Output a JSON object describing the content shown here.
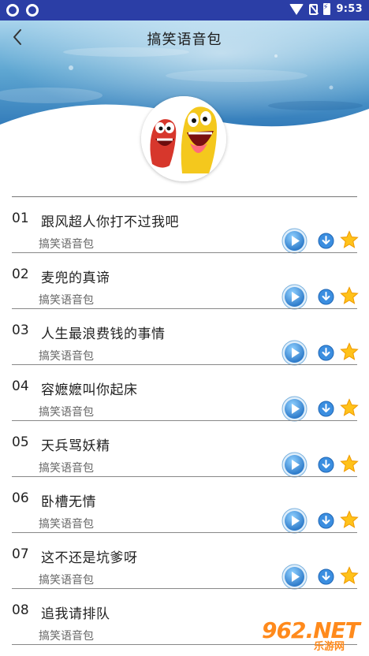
{
  "status_bar": {
    "time": "9:53",
    "left_icons": [
      "sync-icon",
      "sync-icon"
    ],
    "right_icons": [
      "wifi-icon",
      "no-sim-icon",
      "battery-charging-icon"
    ]
  },
  "header": {
    "title": "搞笑语音包",
    "back_icon": "chevron-left-icon"
  },
  "list": {
    "items": [
      {
        "num": "01",
        "title": "跟风超人你打不过我吧",
        "subtitle": "搞笑语音包"
      },
      {
        "num": "02",
        "title": "麦兜的真谛",
        "subtitle": "搞笑语音包"
      },
      {
        "num": "03",
        "title": "人生最浪费钱的事情",
        "subtitle": "搞笑语音包"
      },
      {
        "num": "04",
        "title": "容嬷嬷叫你起床",
        "subtitle": "搞笑语音包"
      },
      {
        "num": "05",
        "title": "天兵骂妖精",
        "subtitle": "搞笑语音包"
      },
      {
        "num": "06",
        "title": "卧槽无情",
        "subtitle": "搞笑语音包"
      },
      {
        "num": "07",
        "title": "这不还是坑爹呀",
        "subtitle": "搞笑语音包"
      },
      {
        "num": "08",
        "title": "追我请排队",
        "subtitle": "搞笑语音包"
      }
    ]
  },
  "watermark": {
    "main": "962.NET",
    "sub": "乐游网"
  },
  "colors": {
    "status_bar": "#2b3ea6",
    "play_button": "#3a8fd8",
    "download_button": "#2f7fd4",
    "star": "#ffc21a"
  }
}
